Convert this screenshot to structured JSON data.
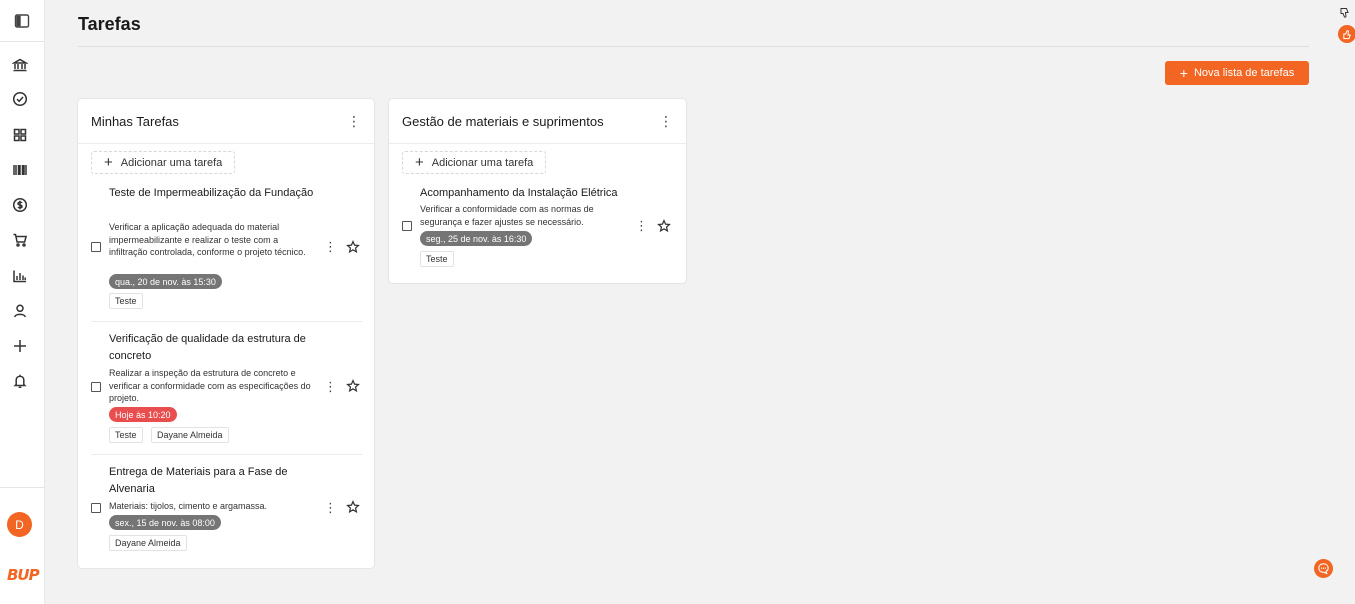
{
  "page": {
    "title": "Tarefas",
    "accent_color": "#f26522"
  },
  "sidebar": {
    "icons": [
      "panel-toggle-icon",
      "bank-icon",
      "check-circle-icon",
      "grid-icon",
      "barcode-icon",
      "dollar-circle-icon",
      "cart-icon",
      "bar-chart-icon",
      "user-icon",
      "plus-icon",
      "bell-icon"
    ],
    "avatar_initial": "D",
    "logo_text": "BUP"
  },
  "toolbar": {
    "new_list_label": "Nova lista de tarefas"
  },
  "lists": [
    {
      "title": "Minhas Tarefas",
      "add_task_label": "Adicionar uma tarefa",
      "tasks": [
        {
          "title": "Teste de Impermeabilização da Fundação",
          "description": "Verificar a aplicação adequada do material impermeabilizante e realizar o teste com a infiltração controlada, conforme o projeto técnico.",
          "date": "qua., 20 de nov. às 15:30",
          "date_status": "normal",
          "tags": [
            "Teste"
          ]
        },
        {
          "title": "Verificação de qualidade da estrutura de concreto",
          "description": "Realizar a inspeção da estrutura de concreto e verificar a conformidade com as especificações do projeto.",
          "date": "Hoje às 10:20",
          "date_status": "today",
          "tags": [
            "Teste",
            "Dayane Almeida"
          ]
        },
        {
          "title": "Entrega de Materiais para a Fase de Alvenaria",
          "description": "Materiais: tijolos, cimento e argamassa.",
          "date": "sex., 15 de nov. às 08:00",
          "date_status": "normal",
          "tags": [
            "Dayane Almeida"
          ]
        }
      ]
    },
    {
      "title": "Gestão de materiais e suprimentos",
      "add_task_label": "Adicionar uma tarefa",
      "tasks": [
        {
          "title": "Acompanhamento da Instalação Elétrica",
          "description": "Verificar a conformidade com as normas de segurança e fazer ajustes se necessário.",
          "date": "seg., 25 de nov. às 16:30",
          "date_status": "normal",
          "tags": [
            "Teste"
          ]
        }
      ]
    }
  ],
  "colors": {
    "badge_gray": "#757575",
    "badge_red": "#e94e4e"
  }
}
